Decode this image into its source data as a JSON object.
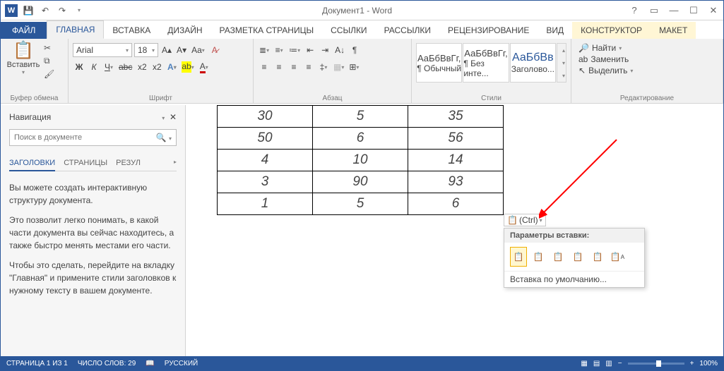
{
  "title": "Документ1 - Word",
  "tabs": {
    "file": "ФАЙЛ",
    "home": "ГЛАВНАЯ",
    "insert": "ВСТАВКА",
    "design": "ДИЗАЙН",
    "layout": "РАЗМЕТКА СТРАНИЦЫ",
    "refs": "ССЫЛКИ",
    "mail": "РАССЫЛКИ",
    "review": "РЕЦЕНЗИРОВАНИЕ",
    "view": "ВИД",
    "ctor": "КОНСТРУКТОР",
    "maket": "МАКЕТ"
  },
  "ribbon": {
    "clipboard": {
      "label": "Буфер обмена",
      "paste": "Вставить"
    },
    "font": {
      "label": "Шрифт",
      "name": "Arial",
      "size": "18"
    },
    "para": {
      "label": "Абзац"
    },
    "styles": {
      "label": "Стили",
      "s1": "АаБбВвГг,",
      "s1n": "¶ Обычный",
      "s2": "АаБбВвГг,",
      "s2n": "¶ Без инте...",
      "s3": "АаБбВв",
      "s3n": "Заголово..."
    },
    "edit": {
      "label": "Редактирование",
      "find": "Найти",
      "replace": "Заменить",
      "select": "Выделить"
    }
  },
  "nav": {
    "title": "Навигация",
    "search_ph": "Поиск в документе",
    "tabs": {
      "h": "ЗАГОЛОВКИ",
      "p": "СТРАНИЦЫ",
      "r": "РЕЗУЛ"
    },
    "p1": "Вы можете создать интерактивную структуру документа.",
    "p2": "Это позволит легко понимать, в какой части документа вы сейчас находитесь, а также быстро менять местами его части.",
    "p3": "Чтобы это сделать, перейдите на вкладку \"Главная\" и примените стили заголовков к нужному тексту в вашем документе."
  },
  "table": [
    [
      "30",
      "5",
      "35"
    ],
    [
      "50",
      "6",
      "56"
    ],
    [
      "4",
      "10",
      "14"
    ],
    [
      "3",
      "90",
      "93"
    ],
    [
      "1",
      "5",
      "6"
    ]
  ],
  "paste": {
    "ctrl": "(Ctrl)",
    "hdr": "Параметры вставки:",
    "deflt": "Вставка по умолчанию..."
  },
  "status": {
    "page": "СТРАНИЦА 1 ИЗ 1",
    "words": "ЧИСЛО СЛОВ: 29",
    "lang": "РУССКИЙ",
    "zoom": "100%"
  }
}
